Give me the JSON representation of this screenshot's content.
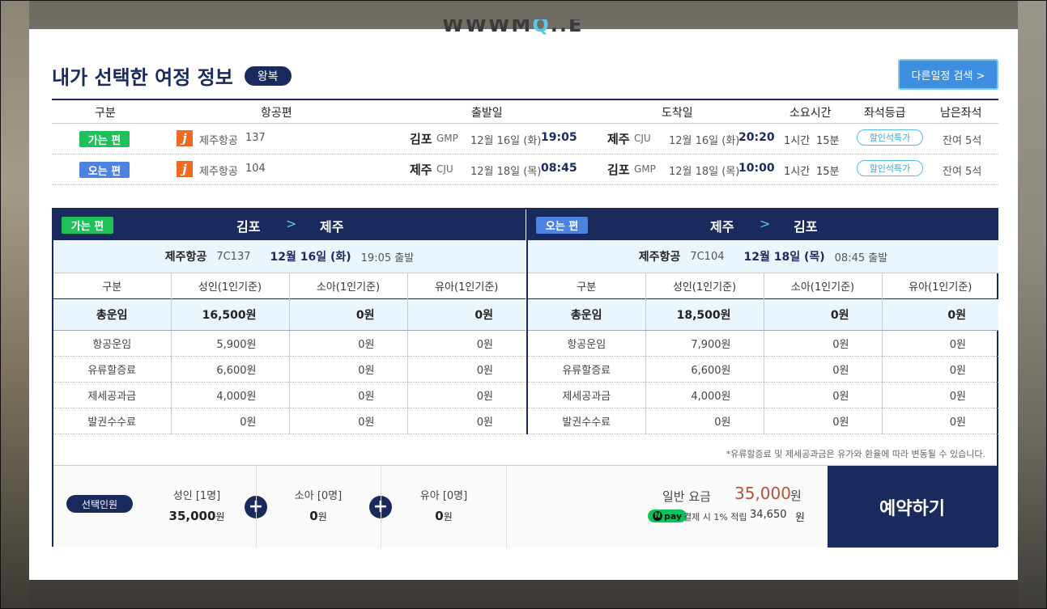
{
  "logo_text": "WWWMQ..E",
  "header": {
    "title": "내가 선택한 여정 정보",
    "trip_type": "왕복",
    "other_search_label": "다른일정 검색 >"
  },
  "itinerary": {
    "columns": [
      "구분",
      "항공편",
      "출발일",
      "도착일",
      "소요시간",
      "좌석등급",
      "남은좌석"
    ],
    "rows": [
      {
        "direction": "가는 편",
        "airline": "제주항공",
        "flight_no": "137",
        "dep_city": "김포",
        "dep_code": "GMP",
        "dep_date": "12월 16일 (화)",
        "dep_time": "19:05",
        "arr_city": "제주",
        "arr_code": "CJU",
        "arr_date": "12월 16일 (화)",
        "arr_time": "20:20",
        "duration_h": "1시간",
        "duration_m": "15분",
        "seat_class": "할인석특가",
        "remaining": "잔여 5석"
      },
      {
        "direction": "오는 편",
        "airline": "제주항공",
        "flight_no": "104",
        "dep_city": "제주",
        "dep_code": "CJU",
        "dep_date": "12월 18일 (목)",
        "dep_time": "08:45",
        "arr_city": "김포",
        "arr_code": "GMP",
        "arr_date": "12월 18일 (목)",
        "arr_time": "10:00",
        "duration_h": "1시간",
        "duration_m": "15분",
        "seat_class": "할인석특가",
        "remaining": "잔여 5석"
      }
    ]
  },
  "fare_panels": [
    {
      "badge": "가는 편",
      "from": "김포",
      "to": "제주",
      "arrow": ">",
      "airline": "제주항공",
      "flight_code": "7C137",
      "date": "12월 16일 (화)",
      "departure": "19:05 출발",
      "headers": [
        "구분",
        "성인(1인기준)",
        "소아(1인기준)",
        "유아(1인기준)"
      ],
      "total": {
        "label": "총운임",
        "adult": "16,500원",
        "child": "0원",
        "infant": "0원"
      },
      "rows": [
        {
          "label": "항공운임",
          "adult": "5,900원",
          "child": "0원",
          "infant": "0원"
        },
        {
          "label": "유류할증료",
          "adult": "6,600원",
          "child": "0원",
          "infant": "0원"
        },
        {
          "label": "제세공과금",
          "adult": "4,000원",
          "child": "0원",
          "infant": "0원"
        },
        {
          "label": "발권수수료",
          "adult": "0원",
          "child": "0원",
          "infant": "0원"
        }
      ]
    },
    {
      "badge": "오는 편",
      "from": "제주",
      "to": "김포",
      "arrow": ">",
      "airline": "제주항공",
      "flight_code": "7C104",
      "date": "12월 18일 (목)",
      "departure": "08:45 출발",
      "headers": [
        "구분",
        "성인(1인기준)",
        "소아(1인기준)",
        "유아(1인기준)"
      ],
      "total": {
        "label": "총운임",
        "adult": "18,500원",
        "child": "0원",
        "infant": "0원"
      },
      "rows": [
        {
          "label": "항공운임",
          "adult": "7,900원",
          "child": "0원",
          "infant": "0원"
        },
        {
          "label": "유류할증료",
          "adult": "6,600원",
          "child": "0원",
          "infant": "0원"
        },
        {
          "label": "제세공과금",
          "adult": "4,000원",
          "child": "0원",
          "infant": "0원"
        },
        {
          "label": "발권수수료",
          "adult": "0원",
          "child": "0원",
          "infant": "0원"
        }
      ]
    }
  ],
  "note": "*유류할증료 및 제세공과금은 유가와 환율에 따라 변동될 수 있습니다.",
  "summary": {
    "selected_label": "선택인원",
    "adult_label": "성인 [1명]",
    "adult_amount": "35,000",
    "won": "원",
    "child_label": "소아 [0명]",
    "child_amount": "0",
    "infant_label": "유아 [0명]",
    "infant_amount": "0",
    "plus": "+",
    "total_label": "일반 요금",
    "total_value": "35,000",
    "total_unit": "원",
    "npay_badge": "pay",
    "npay_n": "N",
    "npay_text": "결제 시 1% 적립",
    "npay_value": "34,650",
    "npay_unit": "원",
    "book_label": "예약하기"
  },
  "colors": {
    "navy": "#1a2a5c",
    "go_green": "#1fbf5a",
    "return_blue": "#4d82e0",
    "price_red": "#b5533c",
    "npay_green": "#03c75a"
  }
}
